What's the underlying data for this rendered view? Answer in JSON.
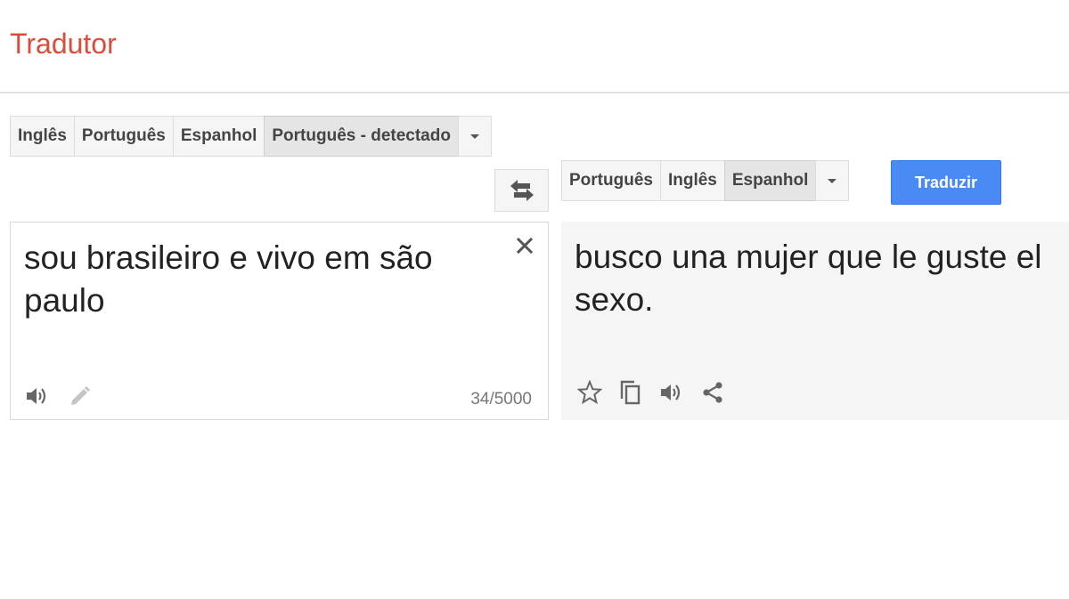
{
  "app": {
    "title": "Tradutor"
  },
  "source": {
    "languages": [
      "Inglês",
      "Português",
      "Espanhol",
      "Português - detectado"
    ],
    "selected_index": 3,
    "text": "sou brasileiro e vivo em são paulo",
    "char_count": "34/5000",
    "icons": [
      "speaker-icon",
      "pencil-icon",
      "close-icon",
      "chevron-down-icon"
    ]
  },
  "target": {
    "languages": [
      "Português",
      "Inglês",
      "Espanhol"
    ],
    "selected_index": 2,
    "text": "busco una mujer que le guste el sexo.",
    "icons": [
      "star-icon",
      "copy-icon",
      "speaker-icon",
      "share-icon",
      "chevron-down-icon"
    ]
  },
  "translate_button": {
    "label": "Traduzir"
  },
  "swap_button": {
    "icon": "swap-languages-icon"
  },
  "colors": {
    "brand": "#dd4b39",
    "accent": "#4a8af4",
    "target_bg": "#f5f5f5"
  }
}
